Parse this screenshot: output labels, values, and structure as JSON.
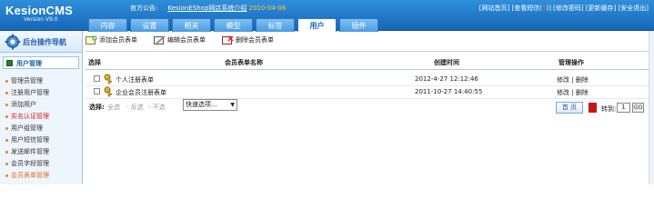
{
  "header": {
    "logo": "KesionCMS",
    "version": "Version V9.0",
    "notice_label": "官方公告:",
    "notice_link": "KesionEShop网店系统介绍",
    "notice_date": "2010-04-06",
    "links": [
      "[网站首页]",
      "[查看短信(",
      "1",
      ")]",
      "[修改密码]",
      "[更新缓存]",
      "[安全退出]"
    ]
  },
  "tabs": [
    "内容",
    "设置",
    "相关",
    "模型",
    "标签",
    "用户",
    "插件"
  ],
  "sidebar": {
    "nav_title": "后台操作导航",
    "section_title": "用户管理",
    "items": [
      "管理员管理",
      "注册用户管理",
      "添加用户",
      "实名认证管理",
      "用户组管理",
      "用户短信管理",
      "发送邮件管理",
      "会员字段管理",
      "会员表单管理"
    ]
  },
  "toolbar": {
    "add": "添加会员表单",
    "edit": "编辑会员表单",
    "delete": "删除会员表单"
  },
  "table": {
    "headers": [
      "选择",
      "会员表单名称",
      "创建时间",
      "管理操作"
    ],
    "rows": [
      {
        "name": "个人注册表单",
        "time": "2012-4-27 12:12:46",
        "edit": "修改",
        "sep": "|",
        "del": "删除"
      },
      {
        "name": "企业会员注册表单",
        "time": "2011-10-27 14:40:55",
        "edit": "修改",
        "sep": "|",
        "del": "删除"
      }
    ]
  },
  "selection": {
    "label": "选择:",
    "all": "全选",
    "invert": "- 反选",
    "none": "- 不选",
    "batch_placeholder": "快速选项..."
  },
  "pager": {
    "first": "首 页",
    "goto": "转到:",
    "page": "1",
    "go": "GO"
  },
  "colors": {
    "header_blue": "#1766b9",
    "notice_date": "#ffcc33",
    "alert_red": "#d81e1e",
    "current_orange": "#e0701a"
  }
}
